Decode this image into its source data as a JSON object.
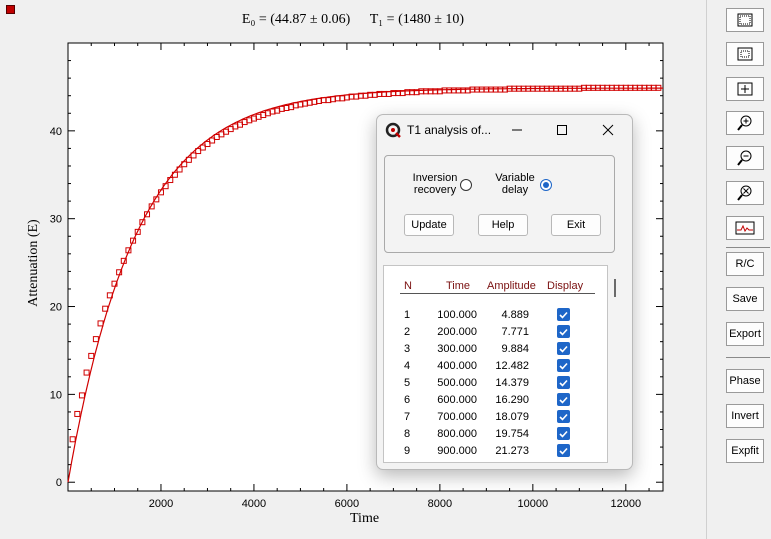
{
  "window": {
    "corner_color": "#c00000"
  },
  "chart_title": {
    "e0": "E₀ = (44.87 ± 0.06)",
    "t1": "T₁ = (1480 ± 10)"
  },
  "chart_data": {
    "type": "scatter",
    "xlabel": "Time",
    "ylabel": "Attenuation (E)",
    "xlim": [
      0,
      12800
    ],
    "ylim": [
      -1,
      50
    ],
    "x_ticks": [
      2000,
      4000,
      6000,
      8000,
      10000,
      12000
    ],
    "y_ticks": [
      0,
      10,
      20,
      30,
      40
    ],
    "grid": false,
    "marker_color": "#d00000",
    "fit_color": "#d00000",
    "fit": {
      "model": "E0*(1-exp(-t/T1))",
      "E0": 44.87,
      "T1": 1480
    },
    "series": [
      {
        "x": [
          100,
          200,
          300,
          400,
          500,
          600,
          700,
          800,
          900,
          1000,
          1100,
          1200,
          1300,
          1400,
          1500,
          1600,
          1700,
          1800,
          1900,
          2000,
          2100,
          2200,
          2300,
          2400,
          2500,
          2600,
          2700,
          2800,
          2900,
          3000,
          3100,
          3200,
          3300,
          3400,
          3500,
          3600,
          3700,
          3800,
          3900,
          4000,
          4100,
          4200,
          4300,
          4400,
          4500,
          4600,
          4700,
          4800,
          4900,
          5000,
          5100,
          5200,
          5300,
          5400,
          5500,
          5600,
          5700,
          5800,
          5900,
          6000,
          6100,
          6200,
          6300,
          6400,
          6500,
          6600,
          6700,
          6800,
          6900,
          7000,
          7100,
          7200,
          7300,
          7400,
          7500,
          7600,
          7700,
          7800,
          7900,
          8000,
          8100,
          8200,
          8300,
          8400,
          8500,
          8600,
          8700,
          8800,
          8900,
          9000,
          9100,
          9200,
          9300,
          9400,
          9500,
          9600,
          9700,
          9800,
          9900,
          10000,
          10100,
          10200,
          10300,
          10400,
          10500,
          10600,
          10700,
          10800,
          10900,
          11000,
          11100,
          11200,
          11300,
          11400,
          11500,
          11600,
          11700,
          11800,
          11900,
          12000,
          12100,
          12200,
          12300,
          12400,
          12500,
          12600,
          12700
        ],
        "y": [
          4.889,
          7.771,
          9.884,
          12.482,
          14.379,
          16.29,
          18.079,
          19.754,
          21.273,
          22.6,
          23.9,
          25.2,
          26.4,
          27.5,
          28.5,
          29.6,
          30.5,
          31.4,
          32.2,
          33.0,
          33.7,
          34.4,
          35.0,
          35.6,
          36.2,
          36.7,
          37.2,
          37.7,
          38.1,
          38.5,
          38.9,
          39.3,
          39.6,
          39.9,
          40.2,
          40.5,
          40.7,
          41.0,
          41.2,
          41.4,
          41.6,
          41.8,
          42.0,
          42.2,
          42.3,
          42.5,
          42.6,
          42.7,
          42.9,
          43.0,
          43.1,
          43.2,
          43.3,
          43.4,
          43.5,
          43.5,
          43.6,
          43.7,
          43.7,
          43.8,
          43.9,
          43.9,
          44.0,
          44.0,
          44.1,
          44.1,
          44.2,
          44.2,
          44.2,
          44.3,
          44.3,
          44.3,
          44.4,
          44.4,
          44.4,
          44.5,
          44.5,
          44.5,
          44.5,
          44.5,
          44.6,
          44.6,
          44.6,
          44.6,
          44.6,
          44.6,
          44.7,
          44.7,
          44.7,
          44.7,
          44.7,
          44.7,
          44.7,
          44.7,
          44.8,
          44.8,
          44.8,
          44.8,
          44.8,
          44.8,
          44.8,
          44.8,
          44.8,
          44.8,
          44.8,
          44.8,
          44.8,
          44.8,
          44.8,
          44.8,
          44.9,
          44.9,
          44.9,
          44.9,
          44.9,
          44.9,
          44.9,
          44.9,
          44.9,
          44.9,
          44.9,
          44.9,
          44.9,
          44.9,
          44.9,
          44.9,
          44.9
        ]
      }
    ]
  },
  "toolbar": {
    "icon_buttons": [
      "select-all-icon",
      "select-region-icon",
      "zoom-box-icon",
      "zoom-in-icon",
      "zoom-out-icon",
      "zoom-reset-icon",
      "spectrum-view-icon"
    ],
    "rc_label": "R/C",
    "save_label": "Save",
    "export_label": "Export",
    "phase_label": "Phase",
    "invert_label": "Invert",
    "expfit_label": "Expfit"
  },
  "dialog": {
    "title": "T1 analysis of...",
    "option_inversion": "Inversion recovery",
    "option_variable": "Variable delay",
    "selected_option": "variable",
    "update_label": "Update",
    "help_label": "Help",
    "exit_label": "Exit",
    "columns": [
      "N",
      "Time",
      "Amplitude",
      "Display"
    ],
    "rows": [
      [
        "1",
        "100.000",
        "4.889",
        true
      ],
      [
        "2",
        "200.000",
        "7.771",
        true
      ],
      [
        "3",
        "300.000",
        "9.884",
        true
      ],
      [
        "4",
        "400.000",
        "12.482",
        true
      ],
      [
        "5",
        "500.000",
        "14.379",
        true
      ],
      [
        "6",
        "600.000",
        "16.290",
        true
      ],
      [
        "7",
        "700.000",
        "18.079",
        true
      ],
      [
        "8",
        "800.000",
        "19.754",
        true
      ],
      [
        "9",
        "900.000",
        "21.273",
        true
      ]
    ]
  }
}
